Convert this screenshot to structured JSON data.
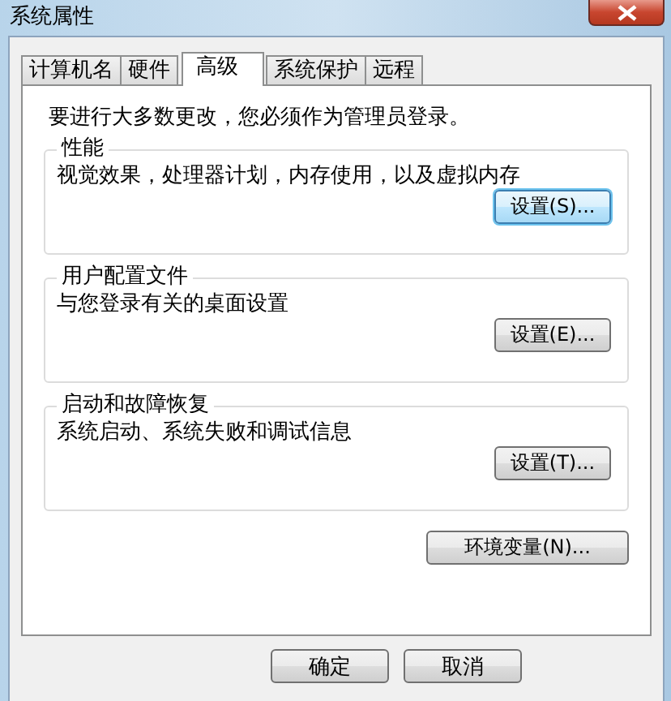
{
  "window": {
    "title": "系统属性"
  },
  "tabs": [
    {
      "label": "计算机名",
      "selected": false
    },
    {
      "label": "硬件",
      "selected": false
    },
    {
      "label": "高级",
      "selected": true
    },
    {
      "label": "系统保护",
      "selected": false
    },
    {
      "label": "远程",
      "selected": false
    }
  ],
  "notice": "要进行大多数更改，您必须作为管理员登录。",
  "groups": [
    {
      "title": "性能",
      "description": "视觉效果，处理器计划，内存使用，以及虚拟内存",
      "button": {
        "label": "设置(S)...",
        "focused": true
      }
    },
    {
      "title": "用户配置文件",
      "description": "与您登录有关的桌面设置",
      "button": {
        "label": "设置(E)...",
        "focused": false
      }
    },
    {
      "title": "启动和故障恢复",
      "description": "系统启动、系统失败和调试信息",
      "button": {
        "label": "设置(T)...",
        "focused": false
      }
    }
  ],
  "env_button": "环境变量(N)...",
  "buttons": [
    "确定",
    "取消"
  ]
}
